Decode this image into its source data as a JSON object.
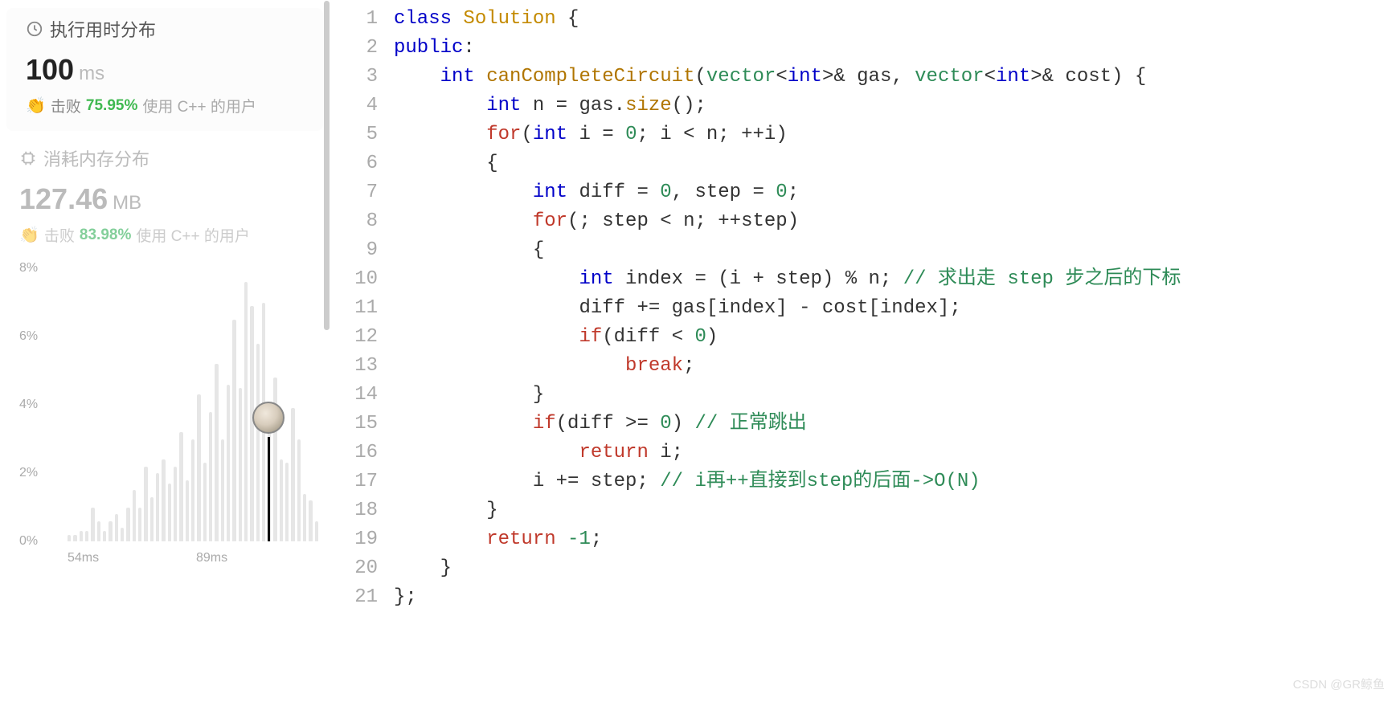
{
  "runtime": {
    "title": "执行用时分布",
    "value": "100",
    "unit": "ms",
    "beats_label": "击败",
    "beats_pct": "75.95%",
    "beats_suffix": "使用 C++ 的用户"
  },
  "memory": {
    "title": "消耗内存分布",
    "value": "127.46",
    "unit": "MB",
    "beats_label": "击败",
    "beats_pct": "83.98%",
    "beats_suffix": "使用 C++ 的用户"
  },
  "chart_data": {
    "type": "bar",
    "ylabel": "",
    "xlabel": "",
    "y_ticks": [
      "8%",
      "6%",
      "4%",
      "2%",
      "0%"
    ],
    "x_ticks": [
      "54ms",
      "89ms"
    ],
    "ylim": [
      0,
      8
    ],
    "marker_x": "100ms",
    "values": [
      0.2,
      0.2,
      0.3,
      0.3,
      1.0,
      0.6,
      0.3,
      0.6,
      0.8,
      0.4,
      1.0,
      1.5,
      1.0,
      2.2,
      1.3,
      2.0,
      2.4,
      1.7,
      2.2,
      3.2,
      1.8,
      3.0,
      4.3,
      2.3,
      3.8,
      5.2,
      3.0,
      4.6,
      6.5,
      4.5,
      7.6,
      6.9,
      5.8,
      7.0,
      3.8,
      4.8,
      2.4,
      2.3,
      3.9,
      3.0,
      1.4,
      1.2,
      0.6
    ]
  },
  "code": {
    "lines": [
      [
        {
          "t": "class ",
          "c": "kw2"
        },
        {
          "t": "Solution",
          "c": "class"
        },
        {
          "t": " {",
          "c": "plain"
        }
      ],
      [
        {
          "t": "public",
          "c": "kw2"
        },
        {
          "t": ":",
          "c": "plain"
        }
      ],
      [
        {
          "t": "    ",
          "c": "plain"
        },
        {
          "t": "int",
          "c": "kw2"
        },
        {
          "t": " ",
          "c": "plain"
        },
        {
          "t": "canCompleteCircuit",
          "c": "func"
        },
        {
          "t": "(",
          "c": "plain"
        },
        {
          "t": "vector",
          "c": "builtin"
        },
        {
          "t": "<",
          "c": "plain"
        },
        {
          "t": "int",
          "c": "kw2"
        },
        {
          "t": ">& gas, ",
          "c": "plain"
        },
        {
          "t": "vector",
          "c": "builtin"
        },
        {
          "t": "<",
          "c": "plain"
        },
        {
          "t": "int",
          "c": "kw2"
        },
        {
          "t": ">& cost) {",
          "c": "plain"
        }
      ],
      [
        {
          "t": "        ",
          "c": "plain"
        },
        {
          "t": "int",
          "c": "kw2"
        },
        {
          "t": " n = gas.",
          "c": "plain"
        },
        {
          "t": "size",
          "c": "func"
        },
        {
          "t": "();",
          "c": "plain"
        }
      ],
      [
        {
          "t": "        ",
          "c": "plain"
        },
        {
          "t": "for",
          "c": "ret"
        },
        {
          "t": "(",
          "c": "plain"
        },
        {
          "t": "int",
          "c": "kw2"
        },
        {
          "t": " i = ",
          "c": "plain"
        },
        {
          "t": "0",
          "c": "num"
        },
        {
          "t": "; i < n; ++i)",
          "c": "plain"
        }
      ],
      [
        {
          "t": "        {",
          "c": "plain"
        }
      ],
      [
        {
          "t": "            ",
          "c": "plain"
        },
        {
          "t": "int",
          "c": "kw2"
        },
        {
          "t": " diff = ",
          "c": "plain"
        },
        {
          "t": "0",
          "c": "num"
        },
        {
          "t": ", step = ",
          "c": "plain"
        },
        {
          "t": "0",
          "c": "num"
        },
        {
          "t": ";",
          "c": "plain"
        }
      ],
      [
        {
          "t": "            ",
          "c": "plain"
        },
        {
          "t": "for",
          "c": "ret"
        },
        {
          "t": "(; step < n; ++step)",
          "c": "plain"
        }
      ],
      [
        {
          "t": "            {",
          "c": "plain"
        }
      ],
      [
        {
          "t": "                ",
          "c": "plain"
        },
        {
          "t": "int",
          "c": "kw2"
        },
        {
          "t": " index = (i + step) % n; ",
          "c": "plain"
        },
        {
          "t": "// 求出走 step 步之后的下标",
          "c": "comment"
        }
      ],
      [
        {
          "t": "                diff += gas[index] - cost[index];",
          "c": "plain"
        }
      ],
      [
        {
          "t": "                ",
          "c": "plain"
        },
        {
          "t": "if",
          "c": "ret"
        },
        {
          "t": "(diff < ",
          "c": "plain"
        },
        {
          "t": "0",
          "c": "num"
        },
        {
          "t": ")",
          "c": "plain"
        }
      ],
      [
        {
          "t": "                    ",
          "c": "plain"
        },
        {
          "t": "break",
          "c": "ret"
        },
        {
          "t": ";",
          "c": "plain"
        }
      ],
      [
        {
          "t": "            }",
          "c": "plain"
        }
      ],
      [
        {
          "t": "            ",
          "c": "plain"
        },
        {
          "t": "if",
          "c": "ret"
        },
        {
          "t": "(diff >= ",
          "c": "plain"
        },
        {
          "t": "0",
          "c": "num"
        },
        {
          "t": ") ",
          "c": "plain"
        },
        {
          "t": "// 正常跳出",
          "c": "comment"
        }
      ],
      [
        {
          "t": "                ",
          "c": "plain"
        },
        {
          "t": "return",
          "c": "ret"
        },
        {
          "t": " i;",
          "c": "plain"
        }
      ],
      [
        {
          "t": "            i += step; ",
          "c": "plain"
        },
        {
          "t": "// i再++直接到step的后面->O(N)",
          "c": "comment"
        }
      ],
      [
        {
          "t": "        }",
          "c": "plain"
        }
      ],
      [
        {
          "t": "        ",
          "c": "plain"
        },
        {
          "t": "return",
          "c": "ret"
        },
        {
          "t": " ",
          "c": "plain"
        },
        {
          "t": "-1",
          "c": "num"
        },
        {
          "t": ";",
          "c": "plain"
        }
      ],
      [
        {
          "t": "    }",
          "c": "plain"
        }
      ],
      [
        {
          "t": "};",
          "c": "plain"
        }
      ]
    ]
  },
  "watermark": "CSDN @GR鲸鱼"
}
